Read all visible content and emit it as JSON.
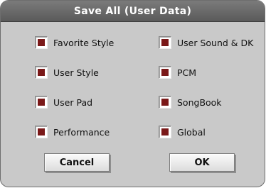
{
  "dialog": {
    "title": "Save All (User Data)",
    "left_column": [
      {
        "label": "Favorite Style",
        "checked": true
      },
      {
        "label": "User Style",
        "checked": true
      },
      {
        "label": "User Pad",
        "checked": true
      },
      {
        "label": "Performance",
        "checked": true
      }
    ],
    "right_column": [
      {
        "label": "User Sound & DK",
        "checked": true
      },
      {
        "label": "PCM",
        "checked": true
      },
      {
        "label": "SongBook",
        "checked": true
      },
      {
        "label": "Global",
        "checked": true
      }
    ],
    "buttons": {
      "cancel_label": "Cancel",
      "ok_label": "OK"
    }
  },
  "colors": {
    "dialog_bg": "#c9c9c9",
    "titlebar_bg": "#6a6a6a",
    "check_mark": "#7a1818"
  }
}
